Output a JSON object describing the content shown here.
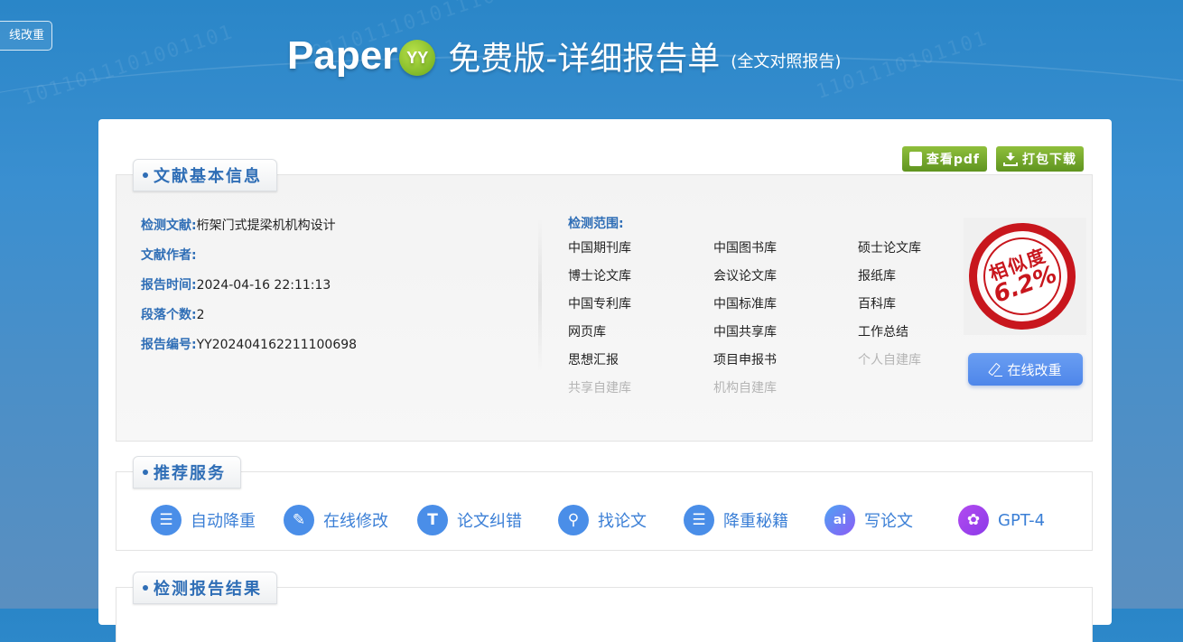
{
  "left_button": {
    "label": "线改重"
  },
  "header": {
    "logo_text": "Paper",
    "logo_mark": "YY",
    "title": "免费版-详细报告单",
    "subtitle": "(全文对照报告)"
  },
  "actions": {
    "view_pdf": "查看pdf",
    "download": "打包下载"
  },
  "basic_info": {
    "tab_title": "文献基本信息",
    "fields": [
      {
        "key": "检测文献:",
        "value": "桁架门式提梁机机构设计"
      },
      {
        "key": "文献作者:",
        "value": ""
      },
      {
        "key": "报告时间:",
        "value": "2024-04-16 22:11:13"
      },
      {
        "key": "段落个数:",
        "value": "2"
      },
      {
        "key": "报告编号:",
        "value": "YY202404162211100698"
      }
    ],
    "range_title": "检测范围:",
    "ranges": [
      {
        "label": "中国期刊库",
        "enabled": true
      },
      {
        "label": "中国图书库",
        "enabled": true
      },
      {
        "label": "硕士论文库",
        "enabled": true
      },
      {
        "label": "博士论文库",
        "enabled": true
      },
      {
        "label": "会议论文库",
        "enabled": true
      },
      {
        "label": "报纸库",
        "enabled": true
      },
      {
        "label": "中国专利库",
        "enabled": true
      },
      {
        "label": "中国标准库",
        "enabled": true
      },
      {
        "label": "百科库",
        "enabled": true
      },
      {
        "label": "网页库",
        "enabled": true
      },
      {
        "label": "中国共享库",
        "enabled": true
      },
      {
        "label": "工作总结",
        "enabled": true
      },
      {
        "label": "思想汇报",
        "enabled": true
      },
      {
        "label": "项目申报书",
        "enabled": true
      },
      {
        "label": "个人自建库",
        "enabled": false
      },
      {
        "label": "共享自建库",
        "enabled": false
      },
      {
        "label": "机构自建库",
        "enabled": false
      }
    ],
    "stamp": {
      "label": "相似度",
      "value": "6.2%",
      "color": "#c8161d"
    },
    "online_edit": "在线改重"
  },
  "recommend": {
    "tab_title": "推荐服务",
    "items": [
      {
        "label": "自动降重",
        "icon": "auto-reduce-icon",
        "glyph": "☰"
      },
      {
        "label": "在线修改",
        "icon": "pencil-icon",
        "glyph": "✎"
      },
      {
        "label": "论文纠错",
        "icon": "text-t-icon",
        "glyph": "T"
      },
      {
        "label": "找论文",
        "icon": "search-icon",
        "glyph": "⚲"
      },
      {
        "label": "降重秘籍",
        "icon": "reduce-guide-icon",
        "glyph": "☰"
      },
      {
        "label": "写论文",
        "icon": "ai-icon",
        "glyph": "ai"
      },
      {
        "label": "GPT-4",
        "icon": "gpt-icon",
        "glyph": "✿"
      }
    ]
  },
  "results": {
    "tab_title": "检测报告结果"
  },
  "colors": {
    "accent": "#2f6eb6",
    "link_blue": "#3b7fd6",
    "green": "#6fa82a",
    "button_blue": "#5a8eee"
  }
}
